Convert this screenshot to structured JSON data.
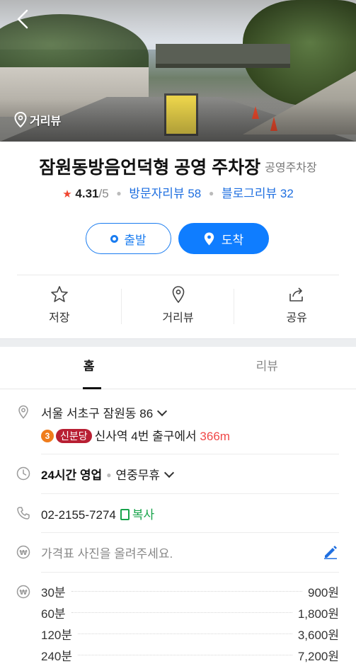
{
  "hero": {
    "streetview_badge": "거리뷰"
  },
  "place": {
    "name": "잠원동방음언덕형 공영 주차장",
    "category": "공영주차장",
    "rating": "4.31",
    "rating_max": "/5",
    "visitor_reviews": "방문자리뷰 58",
    "blog_reviews": "블로그리뷰 32"
  },
  "actions": {
    "depart": "출발",
    "arrive": "도착"
  },
  "quick": {
    "save": "저장",
    "streetview": "거리뷰",
    "share": "공유"
  },
  "tabs": {
    "home": "홈",
    "reviews": "리뷰"
  },
  "info": {
    "address": "서울 서초구 잠원동 86",
    "subway_line_number": "3",
    "subway_line_name": "신분당",
    "subway_directions": "신사역 4번 출구에서",
    "subway_distance": "366m",
    "hours_status": "24시간 영업",
    "hours_note": "연중무휴",
    "phone": "02-2155-7274",
    "copy_label": "복사",
    "price_placeholder": "가격표 사진을 올려주세요."
  },
  "prices": [
    {
      "duration": "30분",
      "price": "900원"
    },
    {
      "duration": "60분",
      "price": "1,800원"
    },
    {
      "duration": "120분",
      "price": "3,600원"
    },
    {
      "duration": "240분",
      "price": "7,200원"
    }
  ],
  "colors": {
    "accent": "#0f7dff",
    "star": "#f0452f",
    "line3": "#ef7c1c",
    "shinbundang": "#b81f33",
    "distance": "#f04848",
    "copy": "#17a34a"
  }
}
